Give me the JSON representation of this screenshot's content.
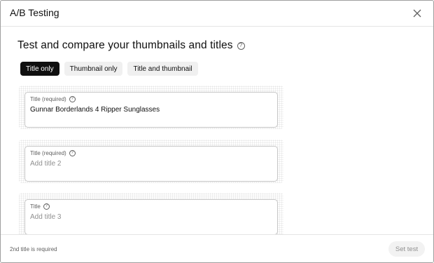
{
  "dialog": {
    "title": "A/B Testing",
    "close_icon": "close-icon"
  },
  "main": {
    "heading": "Test and compare your thumbnails and titles",
    "help_glyph": "?",
    "tabs": [
      {
        "label": "Title only",
        "active": true
      },
      {
        "label": "Thumbnail only",
        "active": false
      },
      {
        "label": "Title and thumbnail",
        "active": false
      }
    ],
    "fields": [
      {
        "label": "Title (required)",
        "value": "Gunnar Borderlands 4 Ripper Sunglasses",
        "placeholder": ""
      },
      {
        "label": "Title (required)",
        "value": "",
        "placeholder": "Add title 2"
      },
      {
        "label": "Title",
        "value": "",
        "placeholder": "Add title 3"
      }
    ]
  },
  "footer": {
    "note": "2nd title is required",
    "set_test_label": "Set test",
    "set_test_enabled": false
  },
  "colors": {
    "active_tab_bg": "#0f0f0f",
    "inactive_tab_bg": "#f0f0f0",
    "disabled_button_bg": "#f2f2f2"
  }
}
